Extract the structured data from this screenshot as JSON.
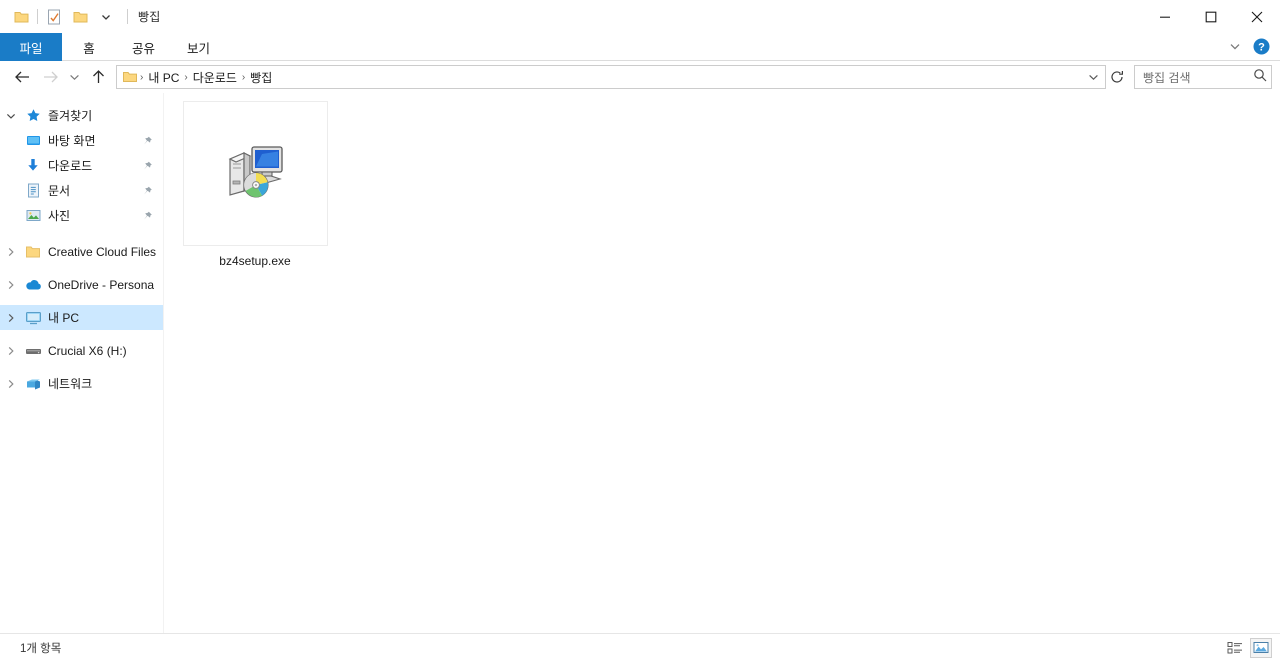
{
  "window": {
    "title": "빵집",
    "quick_access": [
      {
        "name": "folder-icon",
        "label": "새 폴더"
      },
      {
        "name": "properties-icon",
        "label": "속성"
      },
      {
        "name": "folder-icon",
        "label": "새 폴더"
      },
      {
        "name": "chevron-down-icon",
        "label": "빠른 실행 도구 모음 사용자 지정"
      }
    ],
    "controls": {
      "minimize": "─",
      "maximize": "☐",
      "close": "✕"
    }
  },
  "ribbon": {
    "tabs": [
      {
        "label": "파일",
        "active": true
      },
      {
        "label": "홈",
        "active": false
      },
      {
        "label": "공유",
        "active": false
      },
      {
        "label": "보기",
        "active": false
      }
    ],
    "expand_label": "리본 확장",
    "help_label": "도움말"
  },
  "address": {
    "back_label": "뒤로",
    "forward_label": "앞으로",
    "recent_label": "최근 위치",
    "up_label": "위로",
    "breadcrumbs": [
      "내 PC",
      "다운로드",
      "빵집"
    ],
    "separator": "›",
    "dropdown_label": "이전 위치",
    "refresh_label": "새로 고침"
  },
  "search": {
    "placeholder": "빵집 검색",
    "value": "",
    "icon": "search-icon"
  },
  "sidebar": {
    "items": [
      {
        "label": "즐겨찾기",
        "icon": "star-icon",
        "twisty": "expanded",
        "indent": 0,
        "pinned": false,
        "selected": false
      },
      {
        "label": "바탕 화면",
        "icon": "desktop-icon",
        "twisty": "none",
        "indent": 1,
        "pinned": true,
        "selected": false
      },
      {
        "label": "다운로드",
        "icon": "download-icon",
        "twisty": "none",
        "indent": 1,
        "pinned": true,
        "selected": false
      },
      {
        "label": "문서",
        "icon": "document-icon",
        "twisty": "none",
        "indent": 1,
        "pinned": true,
        "selected": false
      },
      {
        "label": "사진",
        "icon": "pictures-icon",
        "twisty": "none",
        "indent": 1,
        "pinned": true,
        "selected": false
      },
      {
        "label": "Creative Cloud Files",
        "icon": "folder-icon",
        "twisty": "collapsed",
        "indent": 0,
        "pinned": false,
        "selected": false
      },
      {
        "label": "OneDrive - Persona",
        "icon": "cloud-icon",
        "twisty": "collapsed",
        "indent": 0,
        "pinned": false,
        "selected": false
      },
      {
        "label": "내 PC",
        "icon": "computer-icon",
        "twisty": "collapsed",
        "indent": 0,
        "pinned": false,
        "selected": true
      },
      {
        "label": "Crucial X6 (H:)",
        "icon": "drive-icon",
        "twisty": "collapsed",
        "indent": 0,
        "pinned": false,
        "selected": false
      },
      {
        "label": "네트워크",
        "icon": "network-icon",
        "twisty": "collapsed",
        "indent": 0,
        "pinned": false,
        "selected": false
      }
    ]
  },
  "content": {
    "files": [
      {
        "name": "bz4setup.exe",
        "icon": "setup-installer-icon"
      }
    ]
  },
  "status": {
    "item_count_text": "1개 항목",
    "view_details_label": "자세히",
    "view_large_icons_label": "큰 아이콘",
    "active_view": "large-icons"
  },
  "colors": {
    "accent": "#1a7cc7",
    "selection": "#cce8ff",
    "folder_yellow": "#fcd77f",
    "close_hover": "#e81123"
  }
}
